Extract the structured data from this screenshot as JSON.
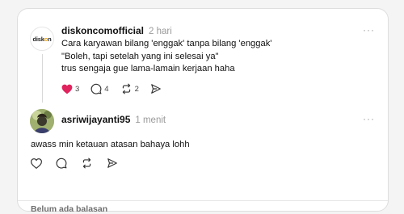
{
  "post": {
    "username": "diskoncomofficial",
    "time": "2 hari",
    "logo_text_a": "disk",
    "logo_text_b": "o",
    "logo_text_c": "n",
    "lines": [
      "Cara karyawan bilang 'enggak' tanpa bilang 'enggak'",
      "\"Boleh, tapi setelah yang ini selesai ya\"",
      "trus sengaja gue lama-lamain kerjaan haha"
    ],
    "likes": "3",
    "comments": "4",
    "reposts": "2",
    "liked_color": "#e0245e"
  },
  "reply": {
    "username": "asriwijayanti95",
    "time": "1 menit",
    "text": "awass min ketauan atasan bahaya lohh"
  },
  "footer": {
    "no_replies": "Belum ada balasan"
  },
  "menu_label": "···"
}
